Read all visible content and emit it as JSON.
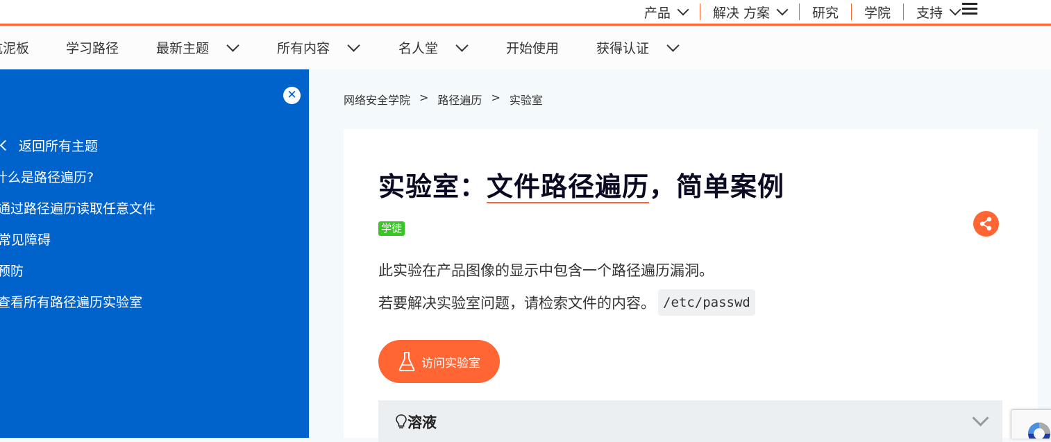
{
  "topnav": {
    "items": [
      {
        "label": "产品"
      },
      {
        "label": "解决 方案"
      },
      {
        "label": "研究"
      },
      {
        "label": "学院"
      },
      {
        "label": "支持"
      }
    ]
  },
  "subnav": {
    "items": [
      {
        "label": "沙坑泥板"
      },
      {
        "label": "学习路径"
      },
      {
        "label": "最新主题"
      },
      {
        "label": "所有内容"
      },
      {
        "label": "名人堂"
      },
      {
        "label": "开始使用"
      },
      {
        "label": "获得认证"
      }
    ]
  },
  "sidebar": {
    "back_label": "返回所有主题",
    "items": [
      {
        "label": "什么是路径遍历?"
      },
      {
        "label": "通过路径遍历读取任意文件"
      },
      {
        "label": "常见障碍"
      },
      {
        "label": "预防"
      },
      {
        "label": "查看所有路径遍历实验室"
      }
    ]
  },
  "breadcrumb": [
    "网络安全学院",
    "路径遍历",
    "实验室"
  ],
  "lab": {
    "title_prefix": "实验室：",
    "title_main": "文件路径遍历",
    "title_suffix": "，简单案例",
    "level": "学徒",
    "desc1": "此实验在产品图像的显示中包含一个路径遍历漏洞。",
    "desc2": "若要解决实验室问题，请检索文件的内容。",
    "code": "/etc/passwd",
    "button": "访问实验室",
    "solution": "溶液"
  },
  "colors": {
    "accent": "#ff6633",
    "sidebar": "#0063cc",
    "badge": "#39c626"
  }
}
